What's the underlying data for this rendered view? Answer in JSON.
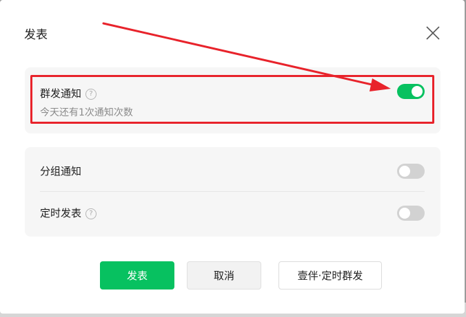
{
  "dialog": {
    "title": "发表"
  },
  "mass_notice": {
    "label": "群发通知",
    "help": "?",
    "sub": "今天还有1次通知次数",
    "enabled": true
  },
  "group_notice": {
    "label": "分组通知",
    "enabled": false
  },
  "scheduled": {
    "label": "定时发表",
    "help": "?",
    "enabled": false
  },
  "footer": {
    "publish": "发表",
    "cancel": "取消",
    "scheduled_mass": "壹伴·定时群发"
  },
  "colors": {
    "accent": "#07c160",
    "annotation": "#e8232b"
  }
}
